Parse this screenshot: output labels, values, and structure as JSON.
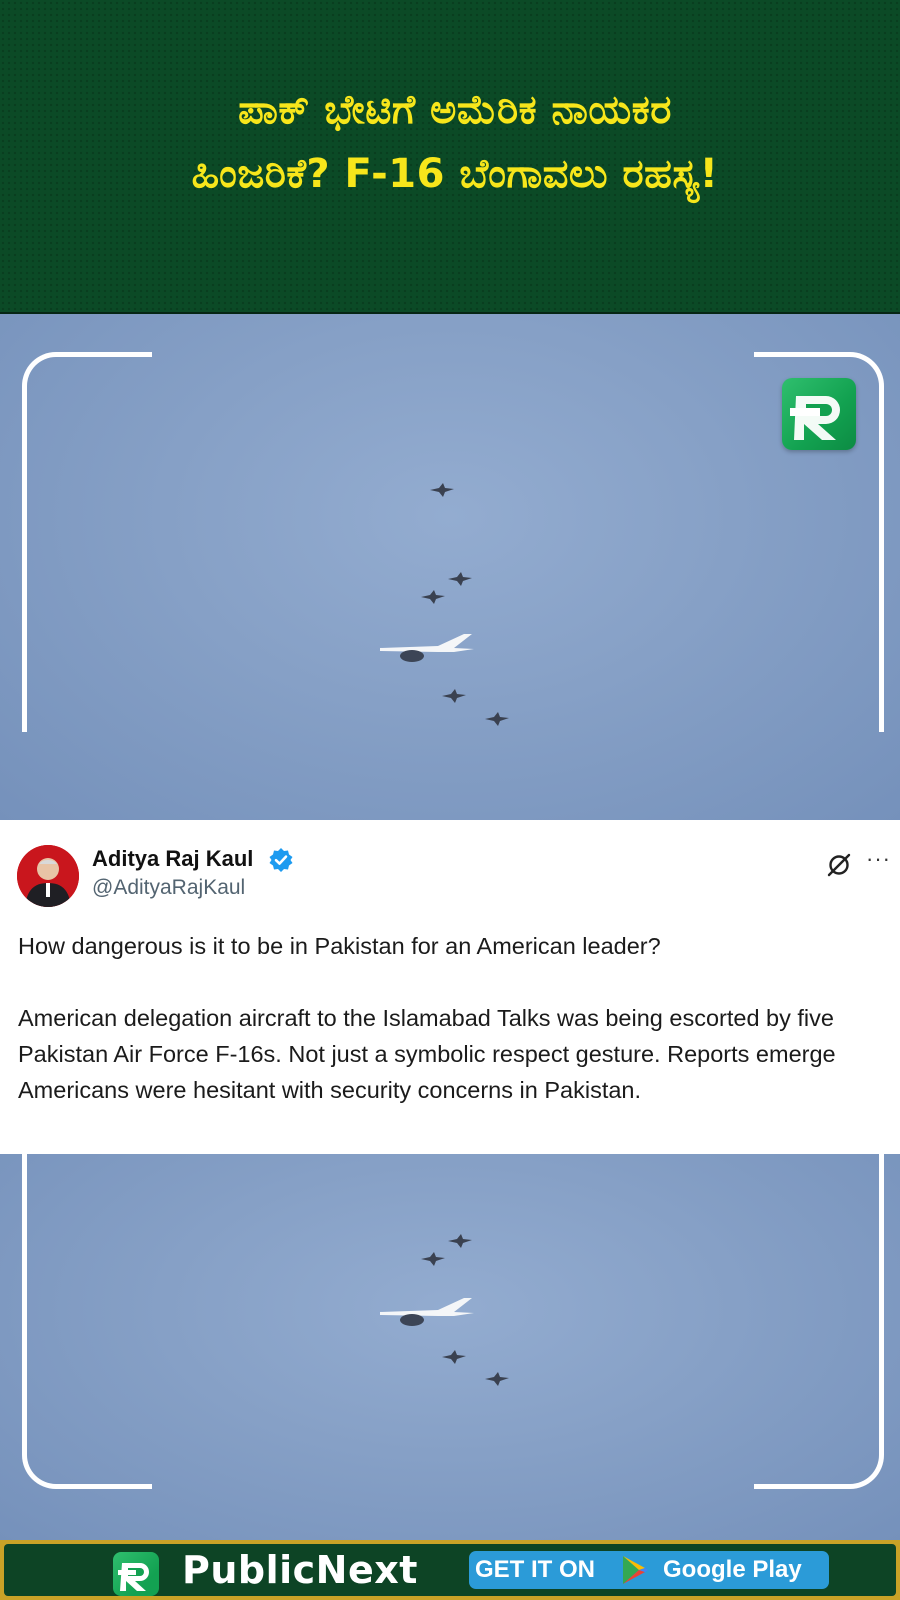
{
  "header": {
    "headline_line1": "ಪಾಕ್ ಭೇಟಿಗೆ ಅಮೆರಿಕ ನಾಯಕರ",
    "headline_line2": "ಹಿಂಜರಿಕೆ? F-16 ಬೆಂಗಾವಲು ರಹಸ್ಯ!",
    "text_color": "#f7e61b",
    "background_color": "#0b4a26"
  },
  "video": {
    "sky_color": "#86a0c6",
    "watermark_logo": "publicnext-logo-icon"
  },
  "tweet": {
    "author_name": "Aditya Raj Kaul",
    "handle": "@AdityaRajKaul",
    "verified_icon": "verified-badge-icon",
    "paragraphs": [
      "How dangerous is it to be in Pakistan for an American leader?",
      "American delegation aircraft to the Islamabad Talks was being escorted by five Pakistan Air Force F-16s. Not just a symbolic respect gesture. Reports emerge Americans were hesitant with security concerns in Pakistan."
    ],
    "more_label": "···",
    "accent_color": "#1d9bf0"
  },
  "footer": {
    "brand": "PublicNext",
    "store_prefix": "GET IT ON",
    "store_name": "Google Play",
    "badge_color": "#2b9bd8",
    "border_color": "#c9a227"
  }
}
